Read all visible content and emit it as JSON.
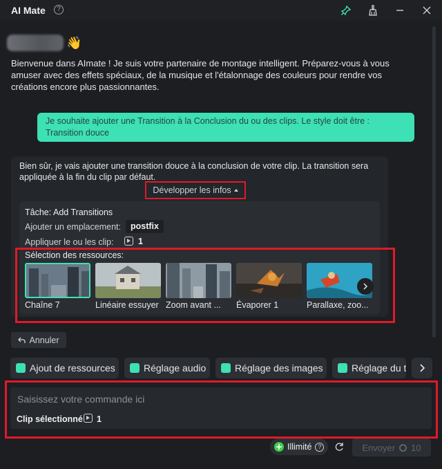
{
  "window": {
    "title": "AI Mate",
    "controls": {
      "pin_icon": "pin-icon",
      "clean_icon": "broom-icon",
      "minimize_icon": "minimize-icon",
      "close_icon": "close-icon"
    }
  },
  "chat": {
    "wave_emoji": "👋",
    "welcome": "Bienvenue dans AImate ! Je suis votre partenaire de montage intelligent. Préparez-vous à vous amuser avec des effets spéciaux, de la musique et l'étalonnage des couleurs pour rendre vos créations encore plus passionnantes.",
    "user_message": "Je souhaite ajouter une Transition à la Conclusion du ou des clips. Le style doit être : Transition douce",
    "bot_reply": "Bien sûr, je vais ajouter une transition douce à la conclusion de votre clip. La transition sera appliquée à la fin du clip par défaut.",
    "develop_label": "Développer les infos",
    "task_label": "Tâche: Add Transitions",
    "placement_label": "Ajouter un emplacement:",
    "placement_value": "postfix",
    "apply_label": "Appliquer le ou les clip:",
    "apply_count": "1",
    "resources_title": "Sélection des ressources:",
    "resources": [
      {
        "name": "Chaîne 7",
        "selected": true
      },
      {
        "name": "Linéaire essuyer",
        "selected": false
      },
      {
        "name": "Zoom avant ...",
        "selected": false
      },
      {
        "name": "Évaporer 1",
        "selected": false
      },
      {
        "name": "Parallaxe, zoo...",
        "selected": false
      }
    ],
    "cancel_label": "Annuler"
  },
  "actions": [
    {
      "label": "Ajout de ressources",
      "icon": "resources-icon"
    },
    {
      "label": "Réglage audio",
      "icon": "audio-icon"
    },
    {
      "label": "Réglage des images",
      "icon": "image-icon"
    },
    {
      "label": "Réglage du t",
      "icon": "text-icon"
    }
  ],
  "composer": {
    "placeholder": "Saisissez votre commande ici",
    "clip_label": "Clip sélectionné",
    "clip_count": "1",
    "plan_label": "Illimité",
    "send_label": "Envoyer",
    "send_cost": "10"
  },
  "colors": {
    "accent": "#3ee0b5",
    "highlight_border": "#e01a29",
    "background": "#1c1e22"
  }
}
